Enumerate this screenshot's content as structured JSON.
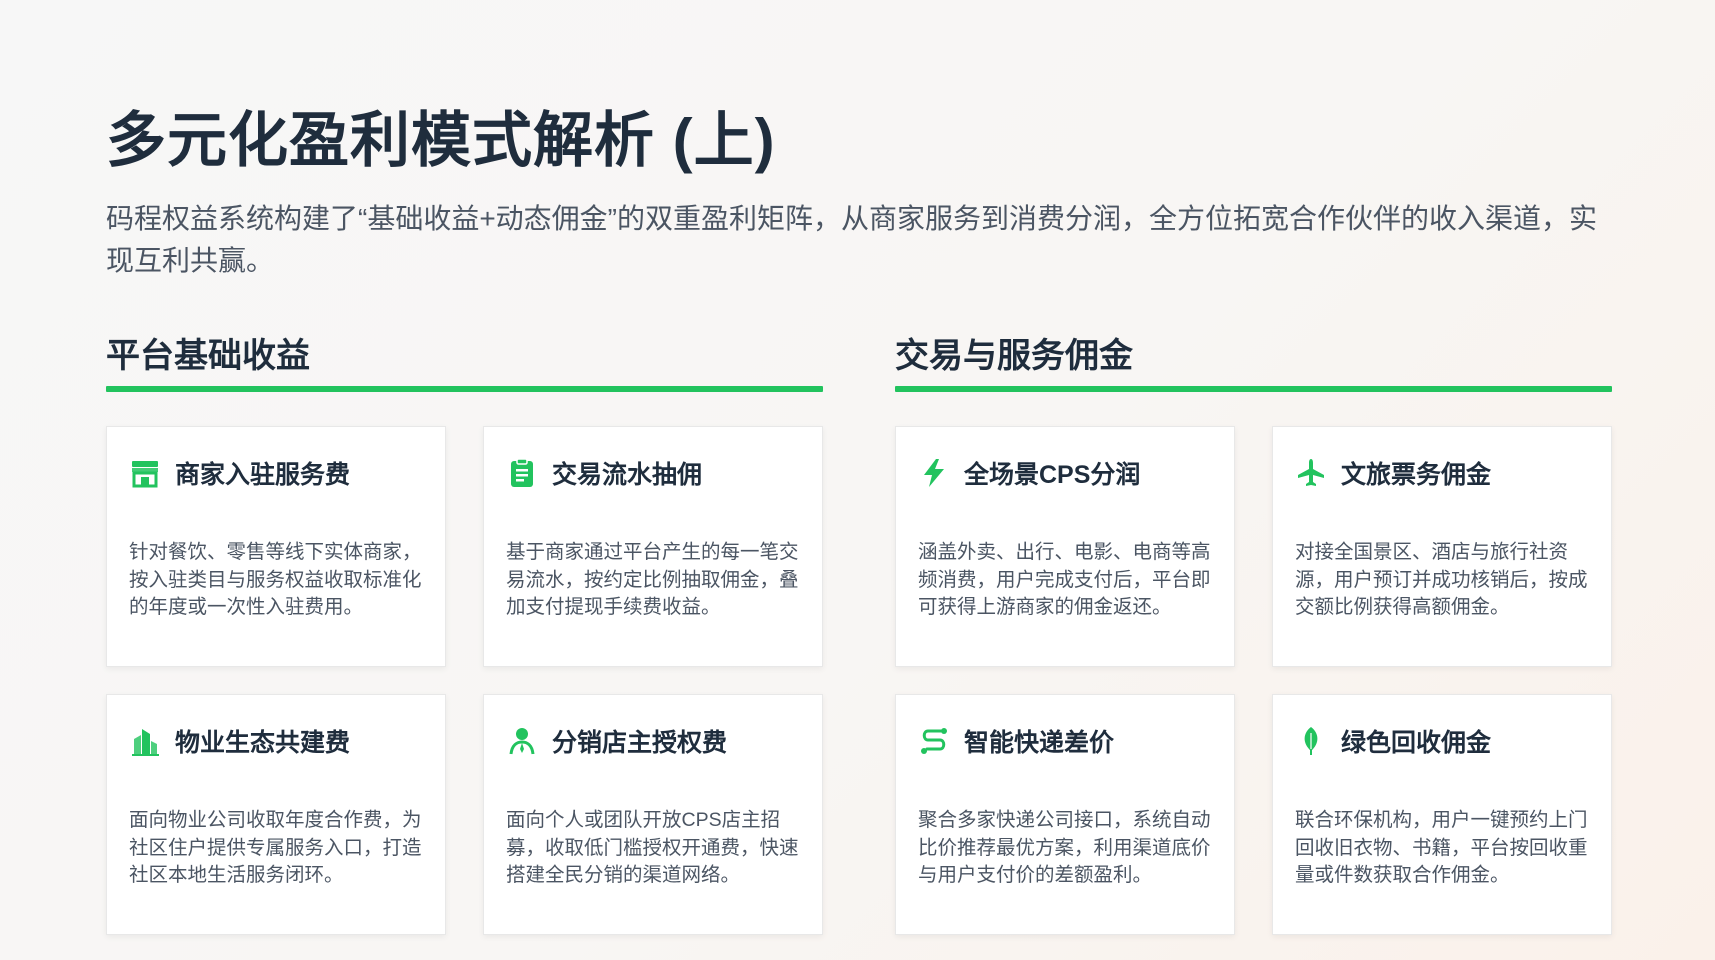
{
  "title": "多元化盈利模式解析 (上)",
  "subtitle": "码程权益系统构建了“基础收益+动态佣金”的双重盈利矩阵，从商家服务到消费分润，全方位拓宽合作伙伴的收入渠道，实现互利共赢。",
  "accent_color": "#22c35e",
  "sections": [
    {
      "title": "平台基础收益",
      "cards": [
        {
          "icon": "storefront-icon",
          "title": "商家入驻服务费",
          "desc": "针对餐饮、零售等线下实体商家，按入驻类目与服务权益收取标准化的年度或一次性入驻费用。"
        },
        {
          "icon": "clipboard-list-icon",
          "title": "交易流水抽佣",
          "desc": "基于商家通过平台产生的每一笔交易流水，按约定比例抽取佣金，叠加支付提现手续费收益。"
        },
        {
          "icon": "buildings-icon",
          "title": "物业生态共建费",
          "desc": "面向物业公司收取年度合作费，为社区住户提供专属服务入口，打造社区本地生活服务闭环。"
        },
        {
          "icon": "user-icon",
          "title": "分销店主授权费",
          "desc": "面向个人或团队开放CPS店主招募，收取低门槛授权开通费，快速搭建全民分销的渠道网络。"
        }
      ]
    },
    {
      "title": "交易与服务佣金",
      "cards": [
        {
          "icon": "lightning-icon",
          "title": "全场景CPS分润",
          "desc": "涵盖外卖、出行、电影、电商等高频消费，用户完成支付后，平台即可获得上游商家的佣金返还。"
        },
        {
          "icon": "airplane-icon",
          "title": "文旅票务佣金",
          "desc": "对接全国景区、酒店与旅行社资源，用户预订并成功核销后，按成交额比例获得高额佣金。"
        },
        {
          "icon": "route-icon",
          "title": "智能快递差价",
          "desc": "聚合多家快递公司接口，系统自动比价推荐最优方案，利用渠道底价与用户支付价的差额盈利。"
        },
        {
          "icon": "leaf-icon",
          "title": "绿色回收佣金",
          "desc": "联合环保机构，用户一键预约上门回收旧衣物、书籍，平台按回收重量或件数获取合作佣金。"
        }
      ]
    }
  ]
}
